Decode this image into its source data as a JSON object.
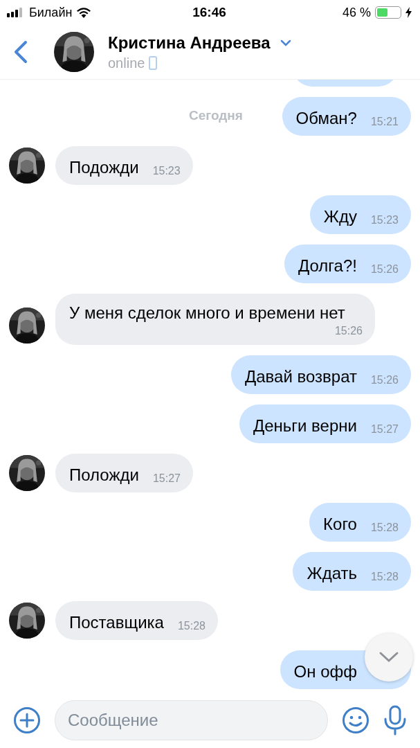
{
  "status_bar": {
    "carrier": "Билайн",
    "time": "16:46",
    "battery": "46 %"
  },
  "header": {
    "name": "Кристина Андреева",
    "status": "online"
  },
  "date_label": "Сегодня",
  "messages": [
    {
      "kind": "out",
      "text": "Обман?",
      "time": "15:21"
    },
    {
      "kind": "in",
      "text": "Подожди",
      "time": "15:23"
    },
    {
      "kind": "out",
      "text": "Жду",
      "time": "15:23"
    },
    {
      "kind": "out",
      "text": "Долга?!",
      "time": "15:26"
    },
    {
      "kind": "in",
      "text": "У меня сделок много и времени нет",
      "time": "15:26"
    },
    {
      "kind": "out",
      "text": "Давай возврат",
      "time": "15:26"
    },
    {
      "kind": "out",
      "text": "Деньги верни",
      "time": "15:27"
    },
    {
      "kind": "in",
      "text": "Положди",
      "time": "15:27"
    },
    {
      "kind": "out",
      "text": "Кого",
      "time": "15:28"
    },
    {
      "kind": "out",
      "text": "Ждать",
      "time": "15:28"
    },
    {
      "kind": "in",
      "text": "Поставщика",
      "time": "15:28"
    },
    {
      "kind": "out",
      "text": "Он офф"
    }
  ],
  "composer": {
    "placeholder": "Сообщение"
  }
}
